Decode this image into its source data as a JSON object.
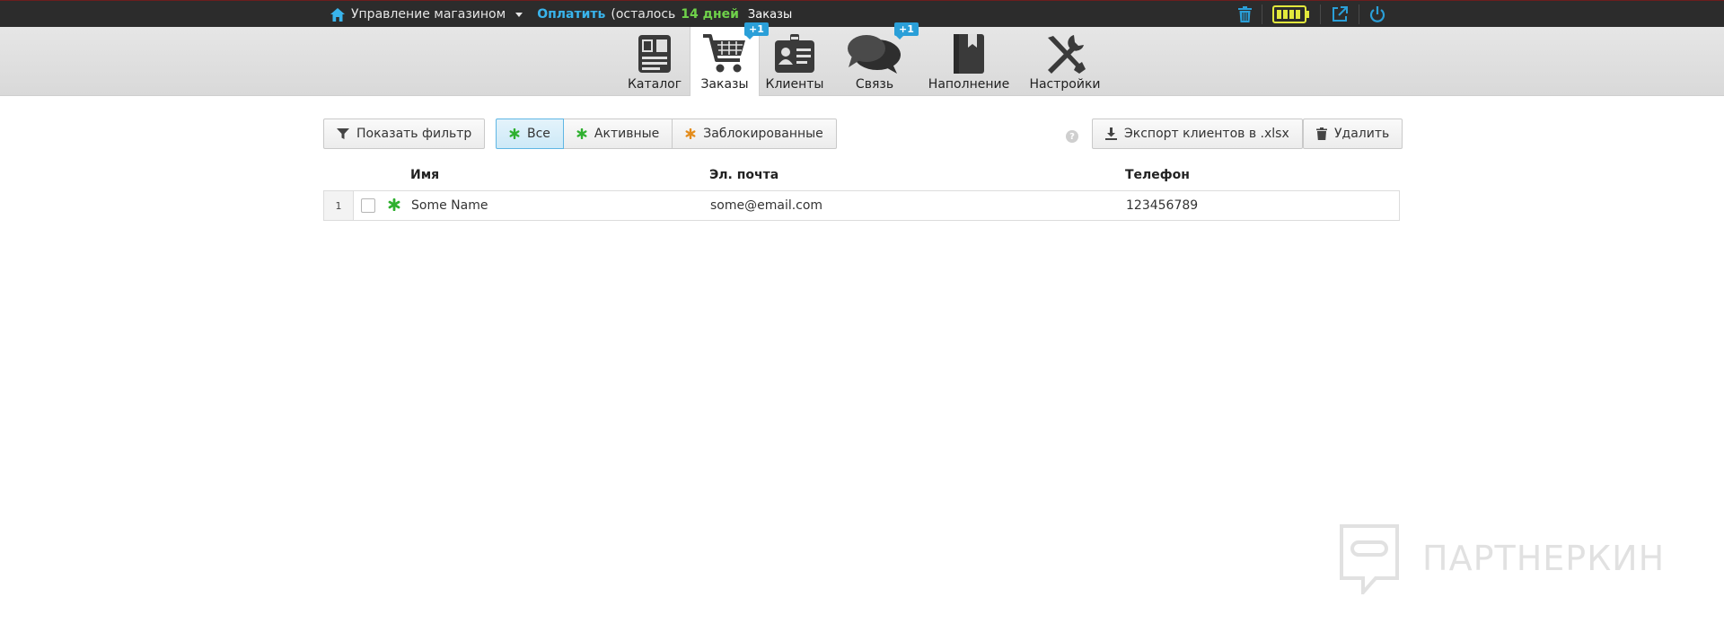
{
  "topbar": {
    "store_label": "Управление магазином",
    "pay_label": "Оплатить",
    "remaining_prefix": "(осталось",
    "remaining_days": "14 дней",
    "orders_label": "Заказы"
  },
  "nav": {
    "tabs": [
      {
        "label": "Каталог",
        "icon": "catalog-icon",
        "active": false
      },
      {
        "label": "Заказы",
        "icon": "cart-icon",
        "active": true,
        "badge": "+1"
      },
      {
        "label": "Клиенты",
        "icon": "badge-icon",
        "active": false
      },
      {
        "label": "Связь",
        "icon": "chat-icon",
        "active": false,
        "badge": "+1"
      },
      {
        "label": "Наполнение",
        "icon": "book-icon",
        "active": false
      },
      {
        "label": "Настройки",
        "icon": "tools-icon",
        "active": false
      }
    ]
  },
  "actions": {
    "filter_label": "Показать фильтр",
    "segments": [
      {
        "label": "Все",
        "selected": true,
        "color": "#2fb02f"
      },
      {
        "label": "Активные",
        "selected": false,
        "color": "#2fb02f"
      },
      {
        "label": "Заблокированные",
        "selected": false,
        "color": "#e38c1c"
      }
    ],
    "help_label": "?",
    "export_label": "Экспорт клиентов в .xlsx",
    "delete_label": "Удалить"
  },
  "table": {
    "columns": [
      "Имя",
      "Эл. почта",
      "Телефон"
    ],
    "rows": [
      {
        "num": "1",
        "name": "Some Name",
        "email": "some@email.com",
        "phone": "123456789"
      }
    ]
  },
  "watermark": {
    "text": "ПАРТНЕРКИН"
  },
  "colors": {
    "accent": "#2a9fd8",
    "battery": "#e2e83c",
    "active_status": "#2fb02f",
    "blocked_status": "#e38c1c"
  }
}
